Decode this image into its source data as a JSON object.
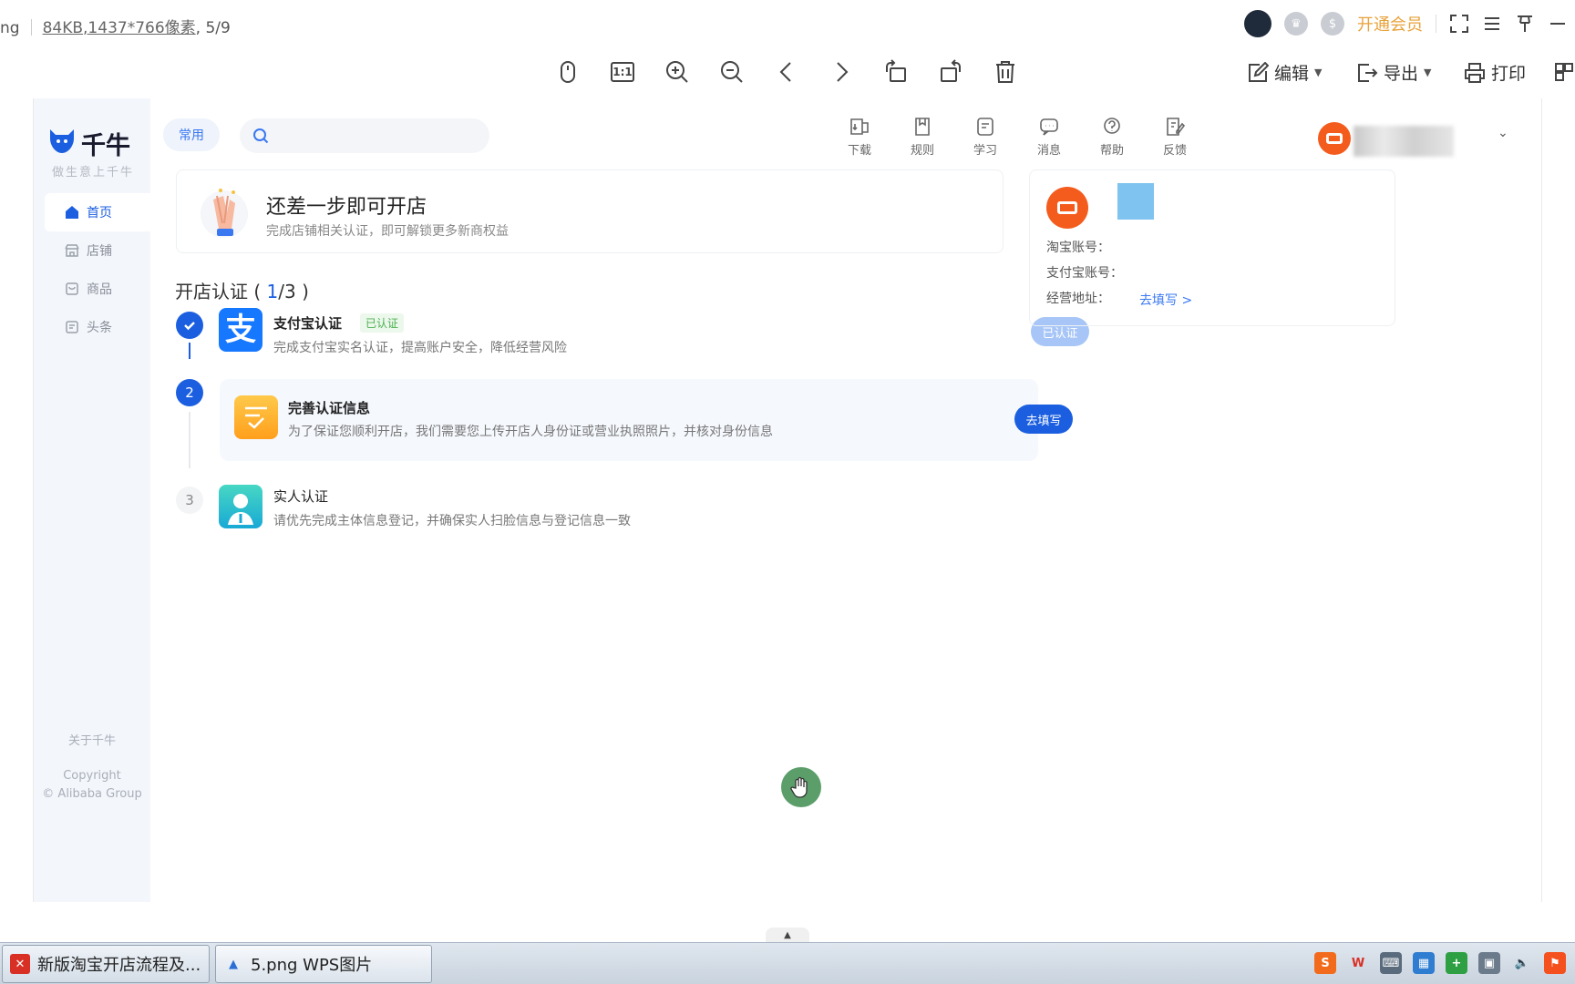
{
  "viewer": {
    "file_ext_fragment": "ng",
    "file_size": "84KB",
    "dimensions": ",1437*766像素",
    "index": ", 5/9",
    "vip_label": "开通会员",
    "toolbar": {
      "edit_label": "编辑",
      "export_label": "导出",
      "print_label": "打印",
      "actual_size_label": "1:1"
    }
  },
  "app": {
    "brand": "千牛",
    "slogan": "做生意上千牛",
    "sidebar": {
      "items": [
        {
          "label": "首页",
          "icon": "home-icon",
          "active": true
        },
        {
          "label": "店铺",
          "icon": "shop-icon",
          "active": false
        },
        {
          "label": "商品",
          "icon": "goods-icon",
          "active": false
        },
        {
          "label": "头条",
          "icon": "news-icon",
          "active": false
        }
      ],
      "about": "关于千牛",
      "copyright": "Copyright",
      "copyright_owner": "© Alibaba Group"
    },
    "header": {
      "chip": "常用",
      "search_placeholder": "",
      "icons": [
        {
          "label": "下载",
          "icon": "download-icon"
        },
        {
          "label": "规则",
          "icon": "rules-icon"
        },
        {
          "label": "学习",
          "icon": "learn-icon"
        },
        {
          "label": "消息",
          "icon": "message-icon"
        },
        {
          "label": "帮助",
          "icon": "help-icon"
        },
        {
          "label": "反馈",
          "icon": "feedback-icon"
        }
      ]
    },
    "banner": {
      "title": "还差一步即可开店",
      "subtitle": "完成店铺相关认证，即可解锁更多新商权益"
    },
    "certification": {
      "title_prefix": "开店认证 ( ",
      "progress_done": "1",
      "progress_total": "/3 )",
      "steps": [
        {
          "number": "",
          "title": "支付宝认证",
          "tag": "已认证",
          "desc": "完成支付宝实名认证，提高账户安全，降低经营风险",
          "button": "已认证",
          "status": "done",
          "icon_glyph": "支"
        },
        {
          "number": "2",
          "title": "完善认证信息",
          "desc": "为了保证您顺利开店，我们需要您上传开店人身份证或营业执照照片，并核对身份信息",
          "button": "去填写",
          "status": "current"
        },
        {
          "number": "3",
          "title": "实人认证",
          "desc": "请优先完成主体信息登记，并确保实人扫脸信息与登记信息一致",
          "status": "pending"
        }
      ]
    },
    "account": {
      "taobao_label": "淘宝账号：",
      "alipay_label": "支付宝账号：",
      "address_label": "经营地址：",
      "address_link": "去填写 >"
    }
  },
  "taskbar": {
    "tasks": [
      {
        "label": "新版淘宝开店流程及...",
        "icon": "wps-office-icon"
      },
      {
        "label": "5.png  WPS图片",
        "icon": "wps-image-icon"
      }
    ]
  },
  "colors": {
    "primary_blue": "#1b5fe0",
    "link_blue": "#3a78f2",
    "vip_orange": "#e8a23a",
    "avatar_orange": "#f45c1e",
    "success_green": "#4caf50"
  }
}
